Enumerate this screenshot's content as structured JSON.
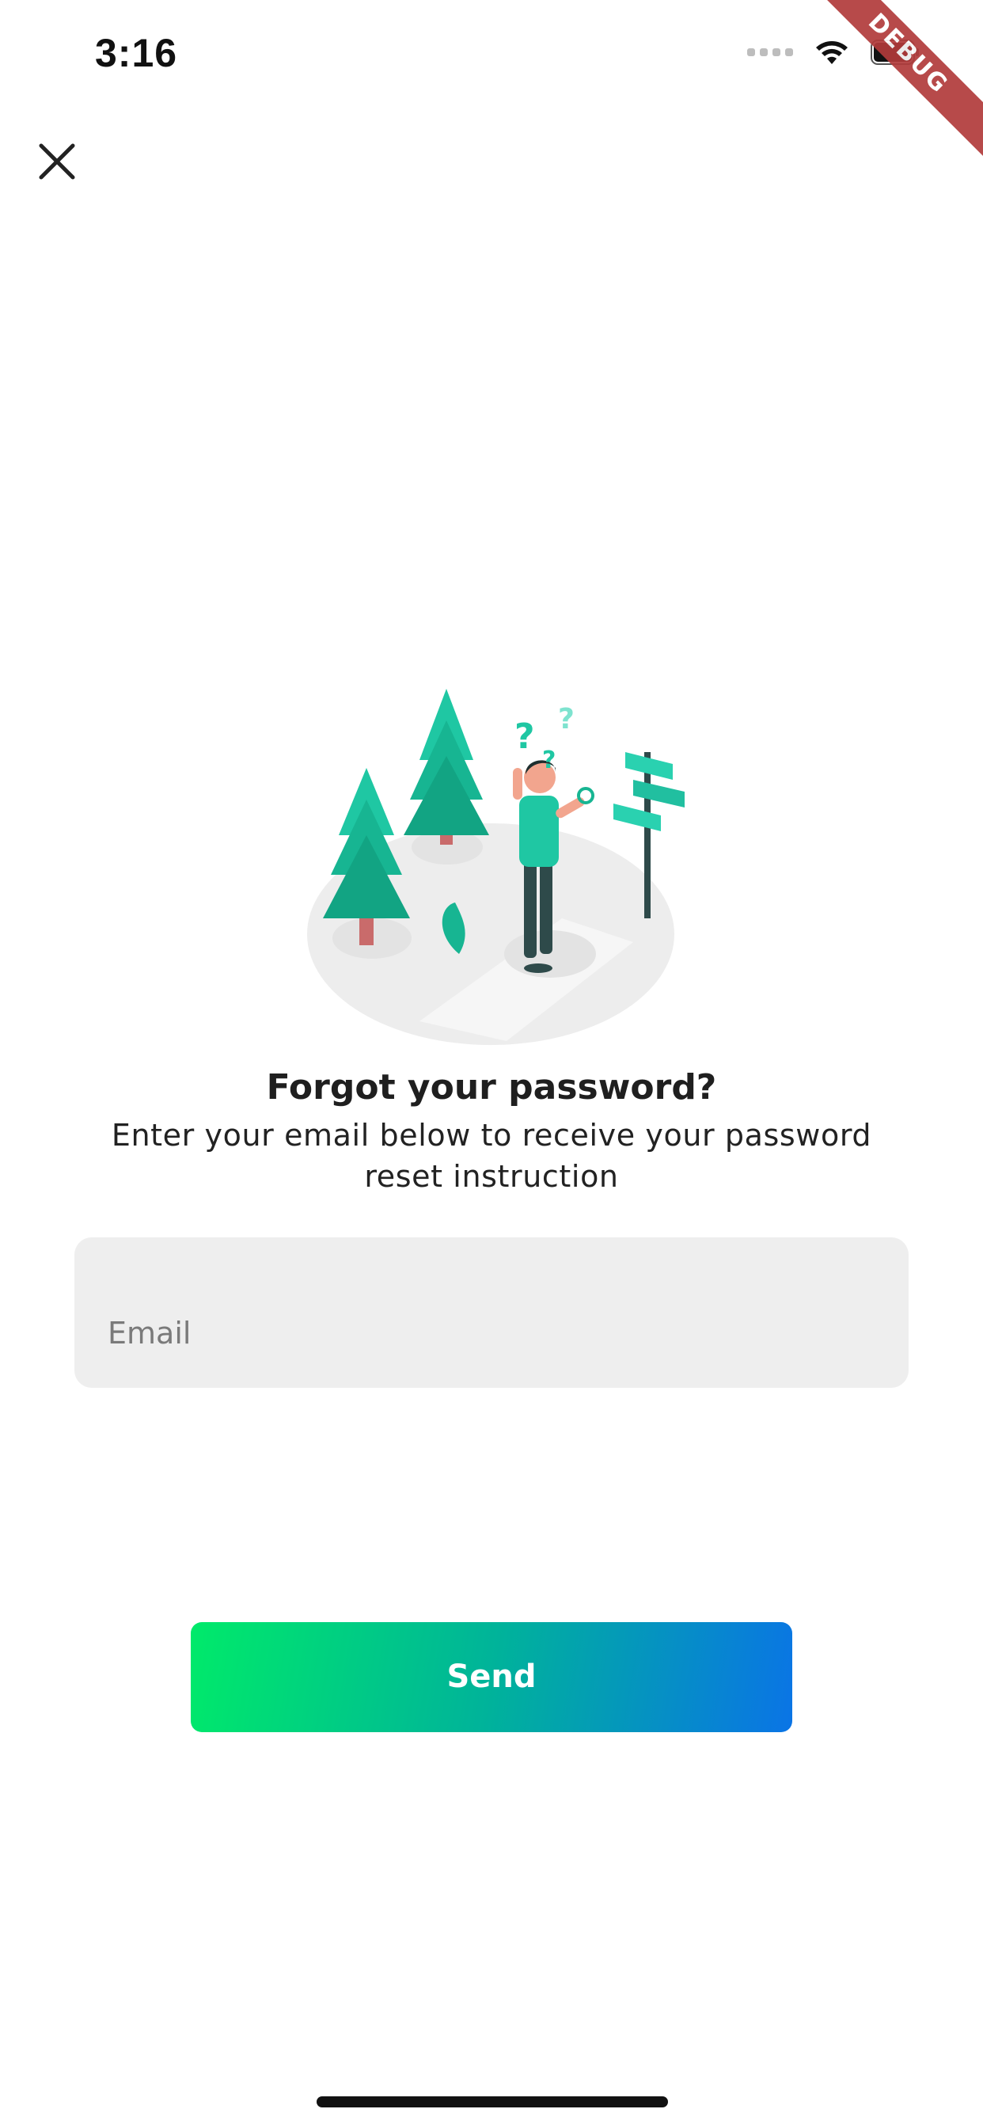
{
  "status_bar": {
    "time": "3:16",
    "icons": [
      "signal-icon",
      "wifi-icon",
      "battery-icon"
    ]
  },
  "debug_banner": {
    "label": "DEBUG",
    "color": "#b13b3b"
  },
  "close_button": {
    "icon": "close-icon"
  },
  "illustration": {
    "icon": "lost-traveler-illustration"
  },
  "content": {
    "title": "Forgot your password?",
    "subtitle": "Enter your email below to receive your password reset instruction"
  },
  "form": {
    "email_value": "",
    "email_placeholder": "Email"
  },
  "send_button": {
    "label": "Send",
    "gradient_start": "#00ea6a",
    "gradient_end": "#0a74e6"
  },
  "colors": {
    "accent": "#19c3a0",
    "field_background": "#eeeeee",
    "text": "#1f1f1f"
  }
}
